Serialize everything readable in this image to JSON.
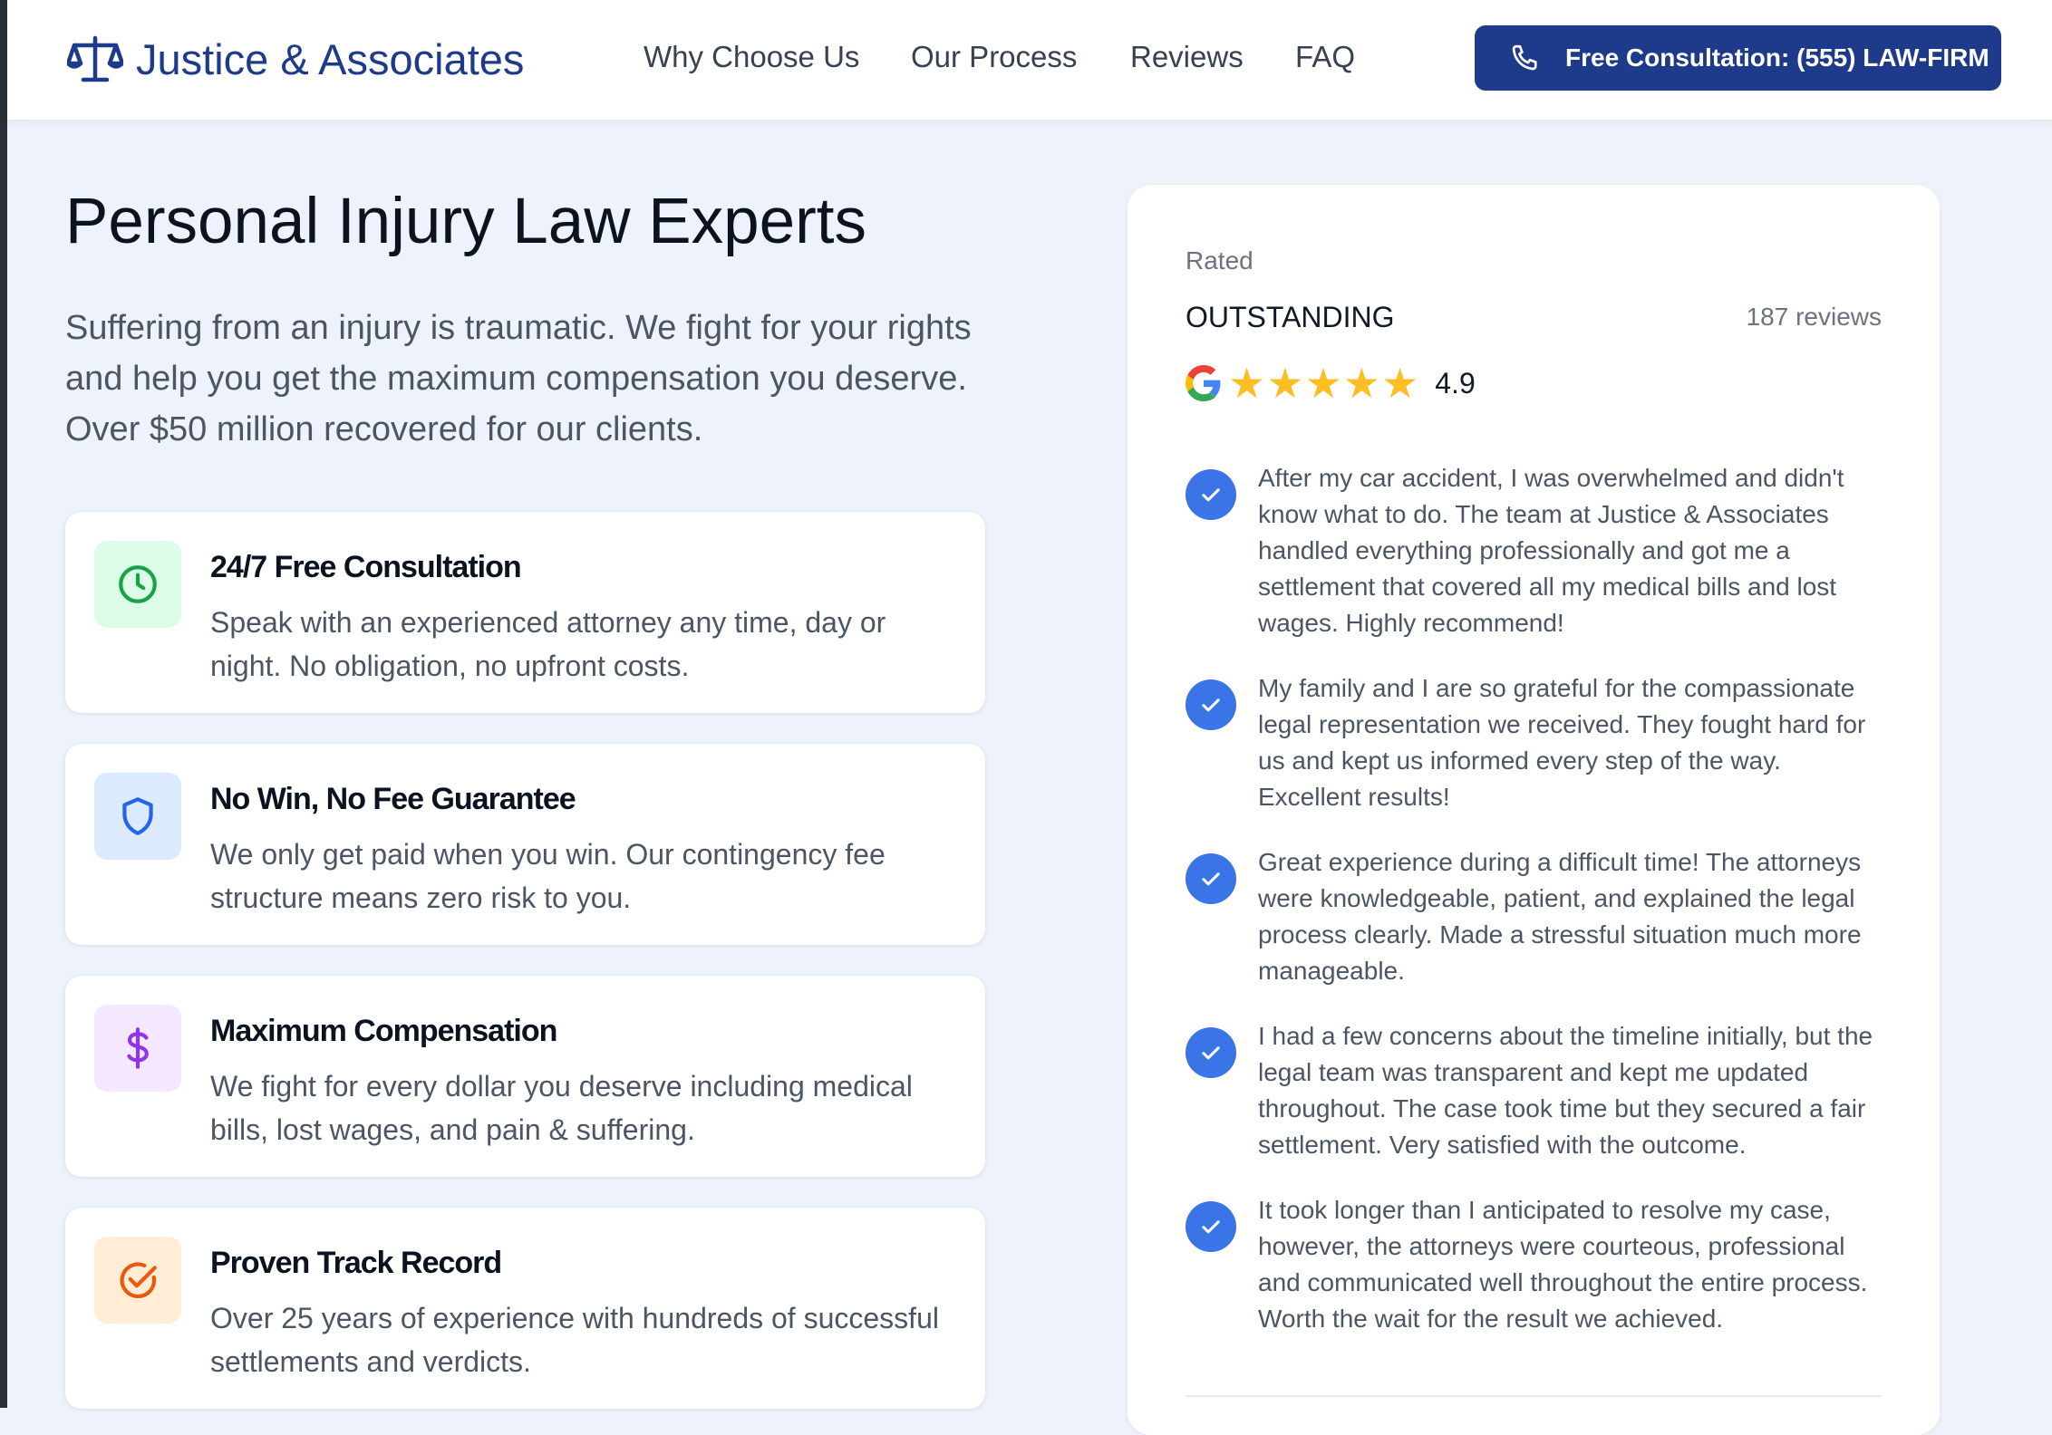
{
  "header": {
    "brand": "Justice & Associates",
    "brand_icon": "scales-icon",
    "nav": [
      "Why Choose Us",
      "Our Process",
      "Reviews",
      "FAQ"
    ],
    "cta_label": "Free Consultation: (555) LAW-FIRM",
    "cta_icon": "phone-icon"
  },
  "hero": {
    "title": "Personal Injury Law Experts",
    "text": "Suffering from an injury is traumatic. We fight for your rights and help you get the maximum compensation you deserve. Over $50 million recovered for our clients."
  },
  "features": [
    {
      "icon": "clock-icon",
      "title": "24/7 Free Consultation",
      "description": "Speak with an experienced attorney any time, day or night. No obligation, no upfront costs."
    },
    {
      "icon": "shield-icon",
      "title": "No Win, No Fee Guarantee",
      "description": "We only get paid when you win. Our contingency fee structure means zero risk to you."
    },
    {
      "icon": "dollar-icon",
      "title": "Maximum Compensation",
      "description": "We fight for every dollar you deserve including medical bills, lost wages, and pain & suffering."
    },
    {
      "icon": "check-circle-icon",
      "title": "Proven Track Record",
      "description": "Over 25 years of experience with hundreds of successful settlements and verdicts."
    }
  ],
  "reviews": {
    "rated_label": "Rated",
    "rating_word": "OUTSTANDING",
    "review_count": "187 reviews",
    "score": "4.9",
    "stars": 5,
    "source_icon": "google-icon",
    "items": [
      "After my car accident, I was overwhelmed and didn't know what to do. The team at Justice & Associates handled everything professionally and got me a settlement that covered all my medical bills and lost wages. Highly recommend!",
      "My family and I are so grateful for the compassionate legal representation we received. They fought hard for us and kept us informed every step of the way. Excellent results!",
      "Great experience during a difficult time! The attorneys were knowledgeable, patient, and explained the legal process clearly. Made a stressful situation much more manageable.",
      "I had a few concerns about the timeline initially, but the legal team was transparent and kept me updated throughout. The case took time but they secured a fair settlement. Very satisfied with the outcome.",
      "It took longer than I anticipated to resolve my case, however, the attorneys were courteous, professional and communicated well throughout the entire process. Worth the wait for the result we achieved."
    ]
  },
  "colors": {
    "brand": "#1e3a8a",
    "page_bg": "#eef3fb",
    "star": "#fbbf24",
    "check": "#3b74e6",
    "clock_bg": "#dcfce7",
    "shield_bg": "#dbeafe",
    "dollar_bg": "#f3e8ff",
    "record_bg": "#ffedd5"
  }
}
